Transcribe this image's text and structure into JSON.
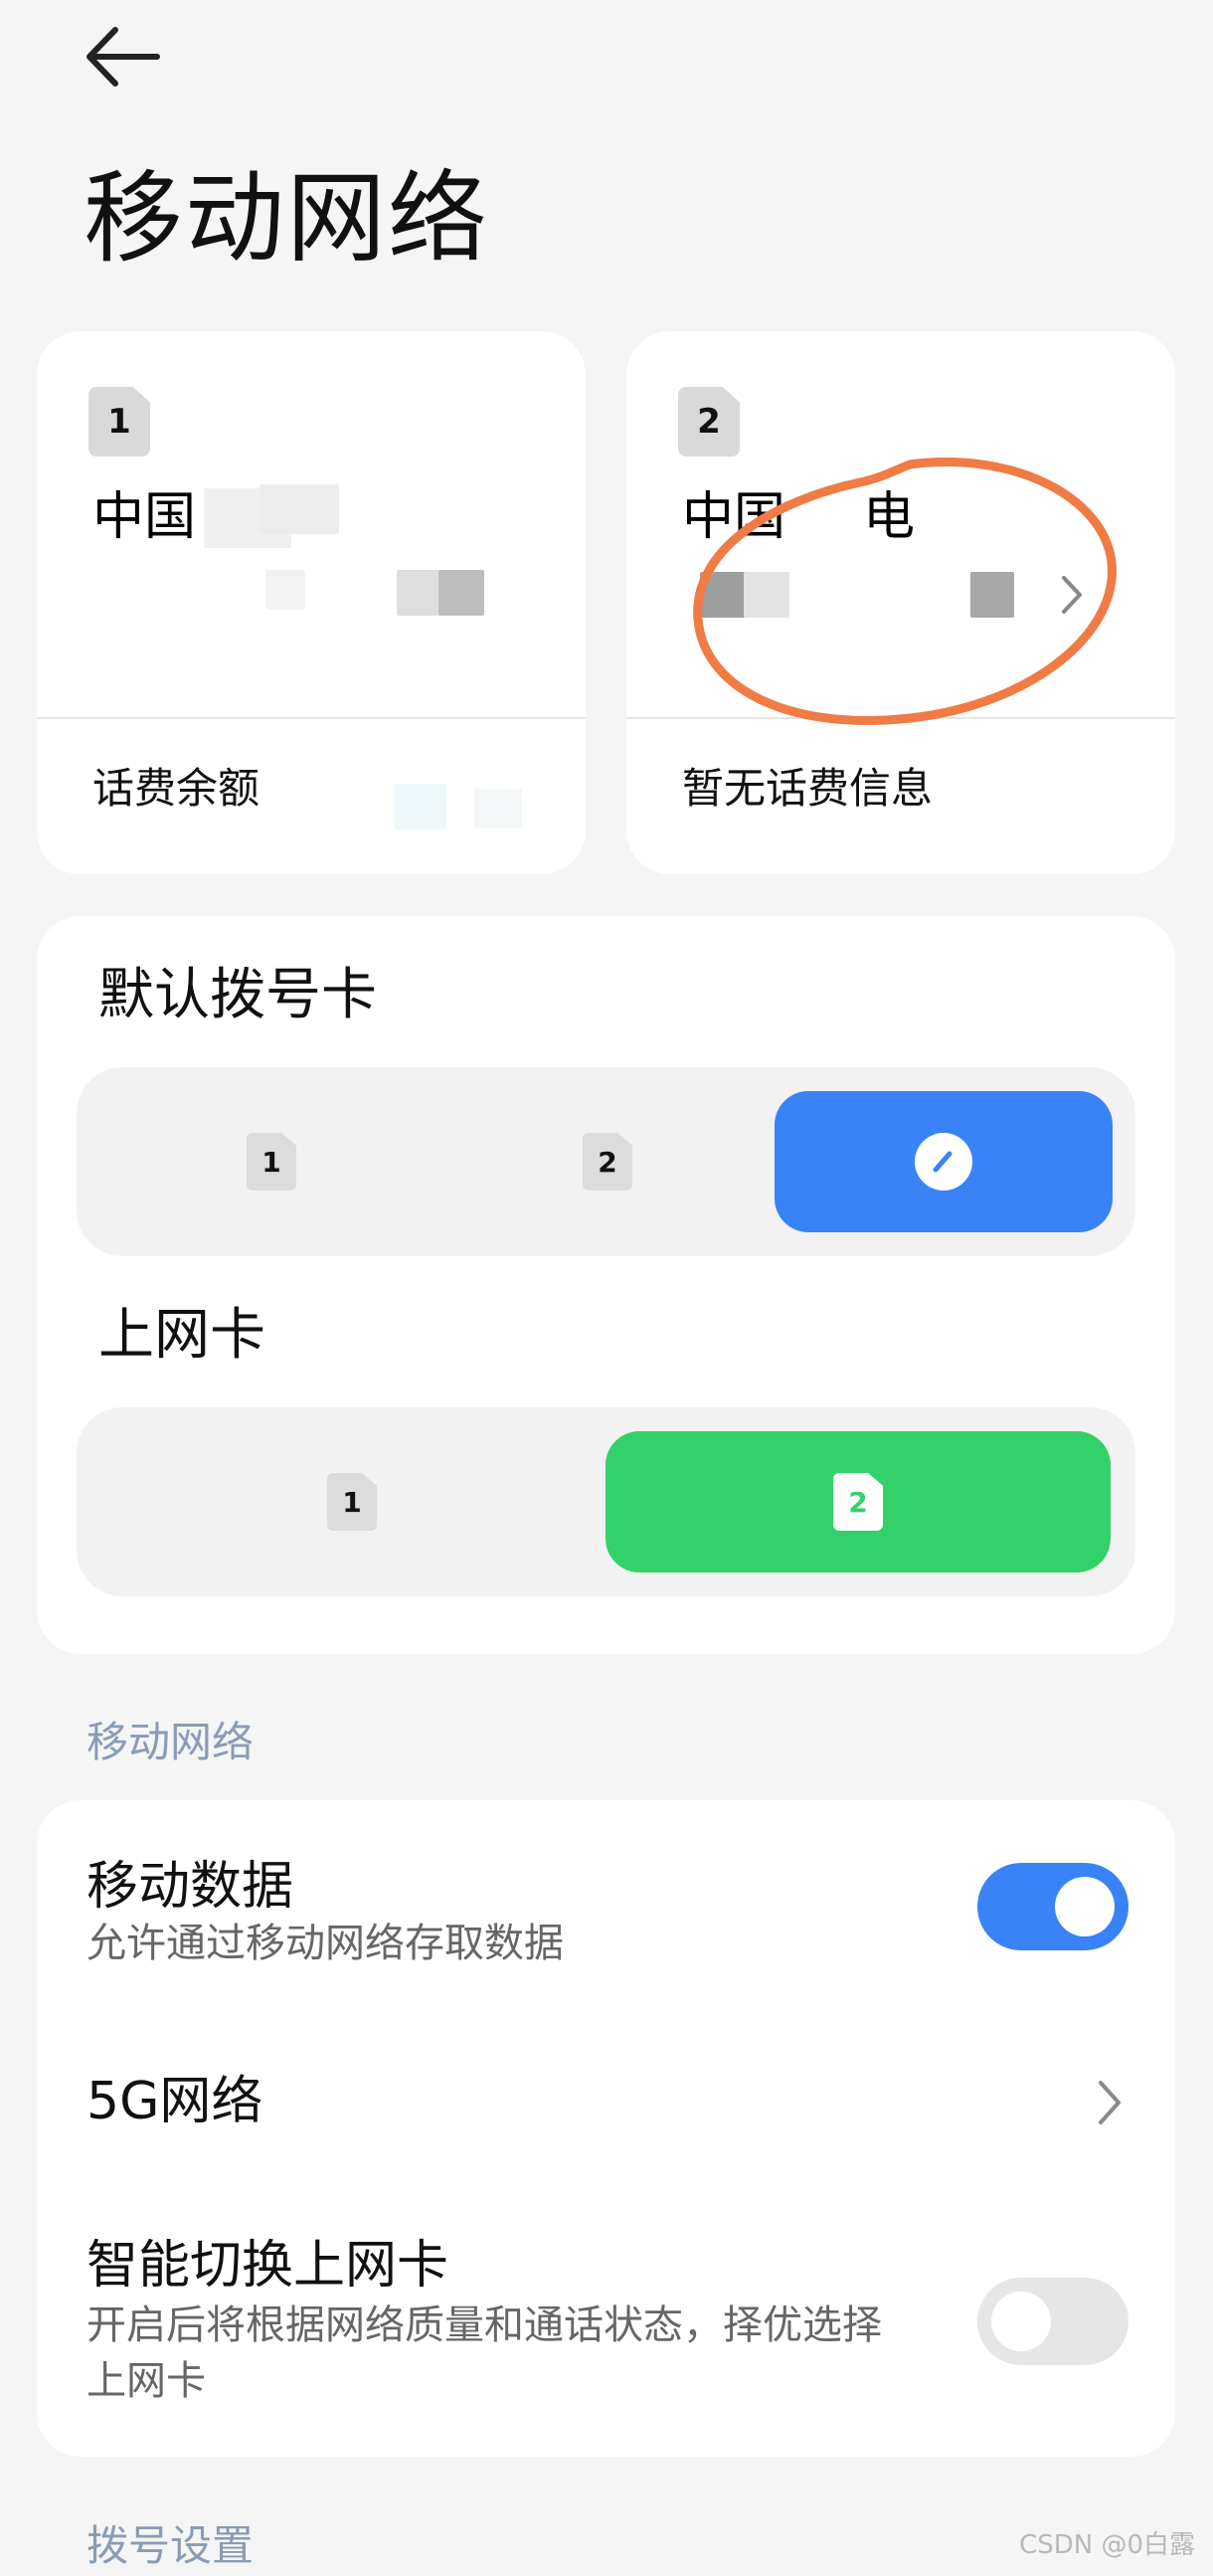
{
  "header": {
    "back_icon": "arrow-left-icon",
    "title": "移动网络"
  },
  "sim_cards": [
    {
      "slot": "1",
      "carrier": "中国",
      "balance_label": "话费余额"
    },
    {
      "slot": "2",
      "carrier": "中国",
      "carrier_suffix": "电",
      "balance_label": "暂无话费信息"
    }
  ],
  "default_dial": {
    "title": "默认拨号卡",
    "options": [
      "1",
      "2"
    ],
    "selected": "ask-each-time",
    "accent": "#3a82f7"
  },
  "data_card": {
    "title": "上网卡",
    "options": [
      "1",
      "2"
    ],
    "selected": "2",
    "accent": "#33d169"
  },
  "mobile_network_section": {
    "label": "移动网络",
    "mobile_data": {
      "title": "移动数据",
      "subtitle": "允许通过移动网络存取数据",
      "enabled": true
    },
    "five_g": {
      "title": "5G网络"
    },
    "smart_switch": {
      "title": "智能切换上网卡",
      "subtitle": "开启后将根据网络质量和通话状态，择优选择",
      "subtitle2": "上网卡",
      "enabled": false
    }
  },
  "dial_settings_section": {
    "label": "拨号设置"
  },
  "annotation_color": "#f07b45",
  "watermark": "CSDN @0白露"
}
